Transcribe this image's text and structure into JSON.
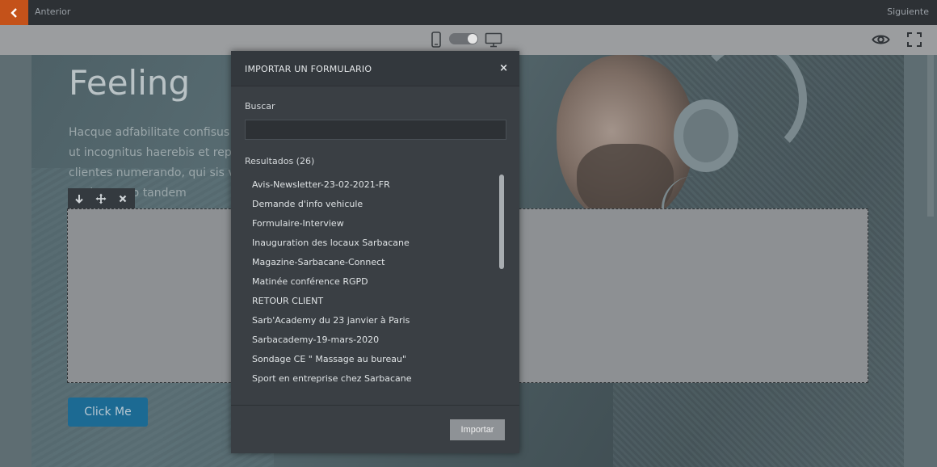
{
  "topbar": {
    "prev_label": "Anterior",
    "next_label": "Siguiente"
  },
  "icons": {
    "back": "chevron-left-icon",
    "mobile": "mobile-icon",
    "desktop": "desktop-icon",
    "preview": "eye-icon",
    "fullscreen": "fullscreen-icon",
    "move_down": "arrow-down-icon",
    "move": "move-icon",
    "delete": "close-icon"
  },
  "hero": {
    "title": "Feeling",
    "text_lines": [
      "Hacque adfabilitate confisus c",
      "ut incognitus haerebis et repe",
      "clientes numerando, qui sis ve",
      "agnitus vero tandem"
    ],
    "cta_label": "Click Me"
  },
  "modal": {
    "title": "IMPORTAR UN FORMULARIO",
    "close_glyph": "×",
    "search_label": "Buscar",
    "search_value": "",
    "results_label": "Resultados (26)",
    "results": [
      "Avis-Newsletter-23-02-2021-FR",
      "Demande d'info vehicule",
      "Formulaire-Interview",
      "Inauguration des locaux Sarbacane",
      "Magazine-Sarbacane-Connect",
      "Matinée conférence RGPD",
      "RETOUR CLIENT",
      "Sarb'Academy du 23 janvier à Paris",
      "Sarbacademy-19-mars-2020",
      "Sondage CE \" Massage au bureau\"",
      "Sport en entreprise chez Sarbacane"
    ],
    "import_label": "Importar"
  },
  "colors": {
    "accent": "#c4521a",
    "cta": "#1c6a93",
    "modal_bg": "#3a3f44"
  }
}
